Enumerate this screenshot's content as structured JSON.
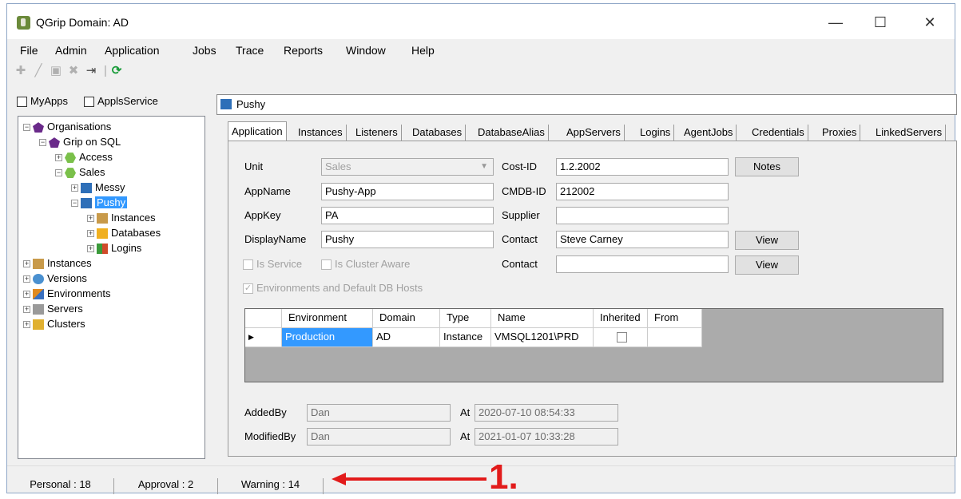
{
  "window": {
    "title": "QGrip Domain: AD",
    "minimize": "—",
    "maximize": "☐",
    "close": "✕"
  },
  "menu": [
    "File",
    "Admin",
    "Application",
    "Jobs",
    "Trace",
    "Reports",
    "Window",
    "Help"
  ],
  "left": {
    "myapps_label": "MyApps",
    "applsservice_label": "ApplsService",
    "tree": {
      "organisations": "Organisations",
      "grip_on_sql": "Grip on SQL",
      "access": "Access",
      "sales": "Sales",
      "messy": "Messy",
      "pushy": "Pushy",
      "instances_child": "Instances",
      "databases_child": "Databases",
      "logins_child": "Logins",
      "instances": "Instances",
      "versions": "Versions",
      "environments": "Environments",
      "servers": "Servers",
      "clusters": "Clusters"
    }
  },
  "header_name": "Pushy",
  "tabs": [
    "Application",
    "Instances",
    "Listeners",
    "Databases",
    "DatabaseAlias",
    "AppServers",
    "Logins",
    "AgentJobs",
    "Credentials",
    "Proxies",
    "LinkedServers"
  ],
  "form": {
    "unit_label": "Unit",
    "unit_value": "Sales",
    "appname_label": "AppName",
    "appname_value": "Pushy-App",
    "appkey_label": "AppKey",
    "appkey_value": "PA",
    "displayname_label": "DisplayName",
    "displayname_value": "Pushy",
    "is_service_label": "Is Service",
    "is_cluster_aware_label": "Is Cluster Aware",
    "env_default_label": "Environments and Default DB Hosts",
    "costid_label": "Cost-ID",
    "costid_value": "1.2.2002",
    "cmdbid_label": "CMDB-ID",
    "cmdbid_value": "212002",
    "supplier_label": "Supplier",
    "supplier_value": "",
    "contact_label": "Contact",
    "contact_value": "Steve Carney",
    "contact2_label": "Contact",
    "contact2_value": "",
    "notes_button": "Notes",
    "view_button": "View",
    "view2_button": "View",
    "addedby_label": "AddedBy",
    "addedby_value": "Dan",
    "modifiedby_label": "ModifiedBy",
    "modifiedby_value": "Dan",
    "at_label": "At",
    "at2_label": "At",
    "added_at_value": "2020-07-10 08:54:33",
    "modified_at_value": "2021-01-07 10:33:28"
  },
  "grid": {
    "headers": [
      "Environment",
      "Domain",
      "Type",
      "Name",
      "Inherited",
      "From"
    ],
    "rows": [
      {
        "environment": "Production",
        "domain": "AD",
        "type": "Instance",
        "name": "VMSQL1201\\PRD",
        "from": ""
      }
    ]
  },
  "status": {
    "personal": "Personal : 18",
    "approval": "Approval : 2",
    "warning": "Warning : 14"
  },
  "annotation": "1.",
  "colors": {
    "accent": "#3399ff",
    "annotation": "#e21b1b"
  }
}
